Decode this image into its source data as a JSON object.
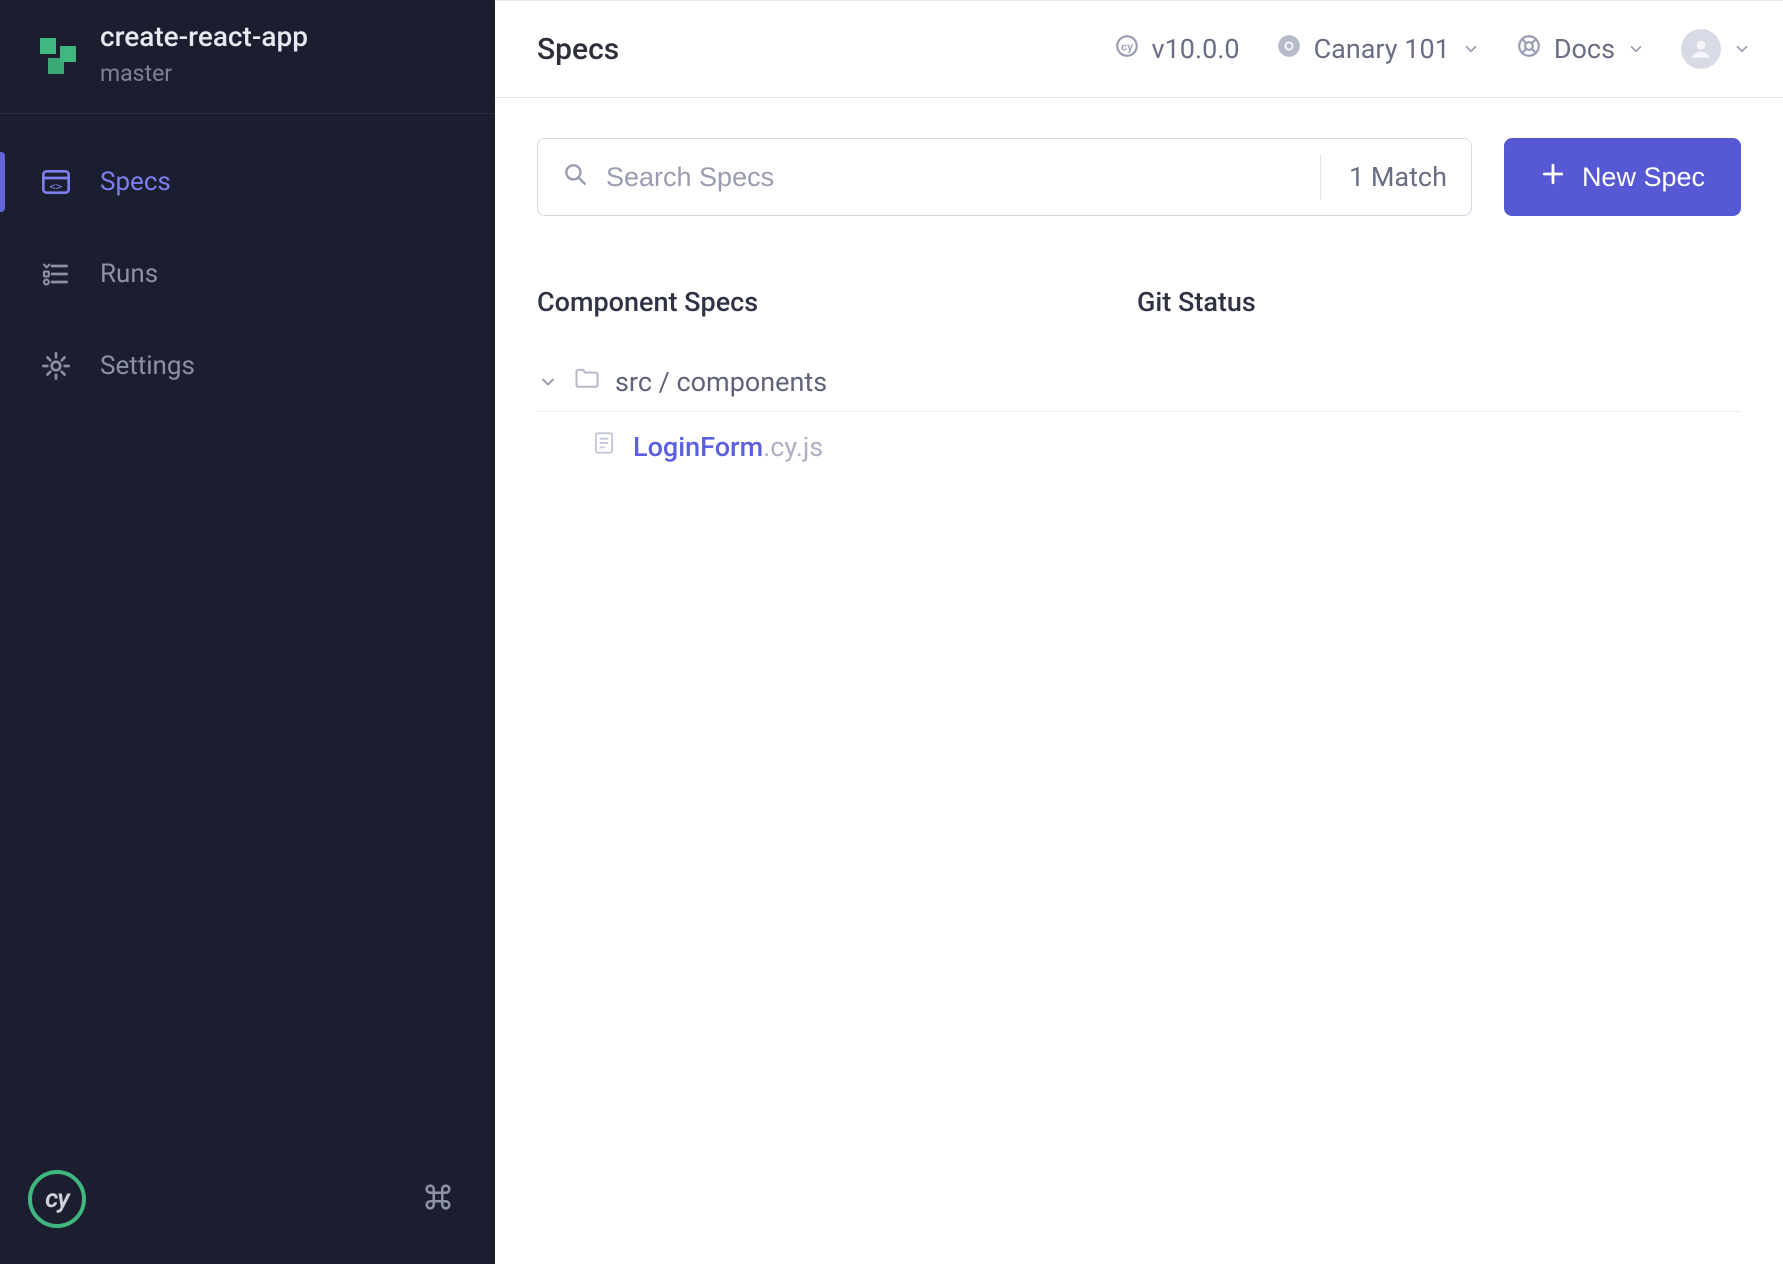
{
  "project": {
    "name": "create-react-app",
    "branch": "master"
  },
  "sidebar": {
    "items": [
      {
        "label": "Specs",
        "icon": "specs-icon",
        "active": true
      },
      {
        "label": "Runs",
        "icon": "runs-icon",
        "active": false
      },
      {
        "label": "Settings",
        "icon": "settings-icon",
        "active": false
      }
    ]
  },
  "header": {
    "page_title": "Specs",
    "version": "v10.0.0",
    "browser": "Canary 101",
    "docs_label": "Docs"
  },
  "toolbar": {
    "search_placeholder": "Search Specs",
    "match_count": "1 Match",
    "new_spec_label": "New Spec"
  },
  "columns": {
    "name": "Component Specs",
    "git": "Git Status"
  },
  "tree": {
    "folder_path": "src / components",
    "files": [
      {
        "base": "LoginForm",
        "ext": ".cy.js"
      }
    ]
  },
  "colors": {
    "accent": "#5659d3",
    "sidebar_bg": "#1b1e2e",
    "link": "#5b5fe0"
  }
}
